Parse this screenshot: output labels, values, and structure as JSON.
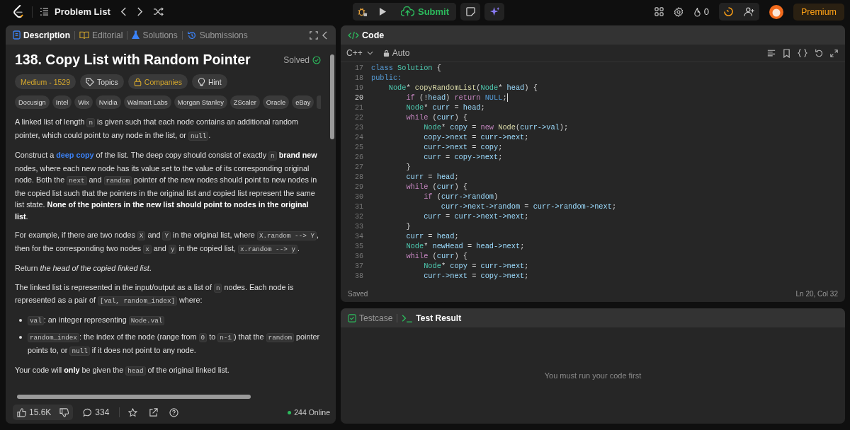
{
  "top_bar": {
    "problem_list": "Problem List",
    "submit": "Submit",
    "streak": "0",
    "premium": "Premium"
  },
  "description_panel": {
    "tabs": [
      {
        "label": "Description",
        "selected": true
      },
      {
        "label": "Editorial",
        "selected": false
      },
      {
        "label": "Solutions",
        "selected": false
      },
      {
        "label": "Submissions",
        "selected": false
      }
    ],
    "title": "138. Copy List with Random Pointer",
    "status": "Solved",
    "tags": [
      {
        "kind": "difficulty",
        "label": "Medium - 1529"
      },
      {
        "kind": "topics",
        "label": "Topics"
      },
      {
        "kind": "companies",
        "label": "Companies"
      },
      {
        "kind": "hint",
        "label": "Hint"
      }
    ],
    "companies": [
      "Docusign",
      "Intel",
      "Wix",
      "Nvidia",
      "Walmart Labs",
      "Morgan Stanley",
      "ZScaler",
      "Oracle",
      "eBay"
    ],
    "content": [
      {
        "kind": "paragraph",
        "parts": [
          {
            "kind": "text",
            "text": "A linked list of length "
          },
          {
            "kind": "code",
            "text": "n"
          },
          {
            "kind": "text",
            "text": " is given such that each node contains an additional random pointer, which could point to any node in the list, or "
          },
          {
            "kind": "code",
            "text": "null"
          },
          {
            "kind": "text",
            "text": "."
          }
        ]
      },
      {
        "kind": "paragraph",
        "parts": [
          {
            "kind": "text",
            "text": "Construct a "
          },
          {
            "kind": "link",
            "text": "deep copy"
          },
          {
            "kind": "text",
            "text": " of the list. The deep copy should consist of exactly "
          },
          {
            "kind": "code",
            "text": "n"
          },
          {
            "kind": "text",
            "text": " **brand new** nodes, where each new node has its value set to the value of its corresponding original node. Both the "
          },
          {
            "kind": "code",
            "text": "next"
          },
          {
            "kind": "text",
            "text": " and "
          },
          {
            "kind": "code",
            "text": "random"
          },
          {
            "kind": "text",
            "text": " pointer of the new nodes should point to new nodes in the copied list such that the pointers in the original list and copied list represent the same list state. **None of the pointers in the new list should point to nodes in the original list**."
          }
        ]
      },
      {
        "kind": "paragraph",
        "parts": [
          {
            "kind": "text",
            "text": "For example, if there are two nodes "
          },
          {
            "kind": "code",
            "text": "X"
          },
          {
            "kind": "text",
            "text": " and "
          },
          {
            "kind": "code",
            "text": "Y"
          },
          {
            "kind": "text",
            "text": " in the original list, where "
          },
          {
            "kind": "code",
            "text": "X.random --> Y"
          },
          {
            "kind": "text",
            "text": ", then for the corresponding two nodes "
          },
          {
            "kind": "code",
            "text": "x"
          },
          {
            "kind": "text",
            "text": " and "
          },
          {
            "kind": "code",
            "text": "y"
          },
          {
            "kind": "text",
            "text": " in the copied list, "
          },
          {
            "kind": "code",
            "text": "x.random --> y"
          },
          {
            "kind": "text",
            "text": "."
          }
        ]
      },
      {
        "kind": "paragraph",
        "parts": [
          {
            "kind": "text",
            "text": "Return *the head of the copied linked list*."
          }
        ]
      },
      {
        "kind": "paragraph",
        "parts": [
          {
            "kind": "text",
            "text": "The linked list is represented in the input/output as a list of "
          },
          {
            "kind": "code",
            "text": "n"
          },
          {
            "kind": "text",
            "text": " nodes. Each node is represented as a pair of "
          },
          {
            "kind": "code",
            "text": "[val, random_index]"
          },
          {
            "kind": "text",
            "text": " where:"
          }
        ]
      },
      {
        "kind": "bullets",
        "items": [
          {
            "parts": [
              {
                "kind": "code",
                "text": "val"
              },
              {
                "kind": "text",
                "text": ": an integer representing "
              },
              {
                "kind": "code",
                "text": "Node.val"
              }
            ]
          },
          {
            "parts": [
              {
                "kind": "code",
                "text": "random_index"
              },
              {
                "kind": "text",
                "text": ": the index of the node (range from "
              },
              {
                "kind": "code",
                "text": "0"
              },
              {
                "kind": "text",
                "text": " to "
              },
              {
                "kind": "code",
                "text": "n-1"
              },
              {
                "kind": "text",
                "text": ") that the "
              },
              {
                "kind": "code",
                "text": "random"
              },
              {
                "kind": "text",
                "text": " pointer points to, or "
              },
              {
                "kind": "code",
                "text": "null"
              },
              {
                "kind": "text",
                "text": " if it does not point to any node."
              }
            ]
          }
        ]
      },
      {
        "kind": "paragraph",
        "parts": [
          {
            "kind": "text",
            "text": "Your code will **only** be given the "
          },
          {
            "kind": "code",
            "text": "head"
          },
          {
            "kind": "text",
            "text": " of the original linked list."
          }
        ]
      }
    ],
    "footer": {
      "likes": "15.6K",
      "comments": "334",
      "online": "244 Online"
    }
  },
  "code_panel": {
    "title": "Code",
    "language": "C++",
    "mode": "Auto",
    "lines": [
      {
        "number": "17",
        "current": false,
        "tokens": [
          {
            "kind": "storage",
            "text": "class "
          },
          {
            "kind": "type",
            "text": "Solution"
          },
          {
            "kind": "plain",
            "text": " {"
          }
        ]
      },
      {
        "number": "18",
        "current": false,
        "tokens": [
          {
            "kind": "storage",
            "text": "public:"
          }
        ]
      },
      {
        "number": "19",
        "current": false,
        "tokens": [
          {
            "kind": "type",
            "text": "    Node"
          },
          {
            "kind": "plain",
            "text": "* "
          },
          {
            "kind": "function",
            "text": "copyRandomList"
          },
          {
            "kind": "plain",
            "text": "("
          },
          {
            "kind": "type",
            "text": "Node"
          },
          {
            "kind": "plain",
            "text": "* "
          },
          {
            "kind": "variable",
            "text": "head"
          },
          {
            "kind": "plain",
            "text": ") {"
          }
        ]
      },
      {
        "number": "20",
        "current": true,
        "tokens": [
          {
            "kind": "keyword",
            "text": "        if"
          },
          {
            "kind": "plain",
            "text": " (!"
          },
          {
            "kind": "variable",
            "text": "head"
          },
          {
            "kind": "plain",
            "text": ") "
          },
          {
            "kind": "keyword",
            "text": "return"
          },
          {
            "kind": "storage",
            "text": " NULL"
          },
          {
            "kind": "plain",
            "text": ";"
          }
        ]
      },
      {
        "number": "21",
        "current": false,
        "tokens": [
          {
            "kind": "type",
            "text": "        Node"
          },
          {
            "kind": "plain",
            "text": "* "
          },
          {
            "kind": "variable",
            "text": "curr"
          },
          {
            "kind": "plain",
            "text": " = "
          },
          {
            "kind": "variable",
            "text": "head"
          },
          {
            "kind": "plain",
            "text": ";"
          }
        ]
      },
      {
        "number": "22",
        "current": false,
        "tokens": [
          {
            "kind": "keyword",
            "text": "        while"
          },
          {
            "kind": "plain",
            "text": " ("
          },
          {
            "kind": "variable",
            "text": "curr"
          },
          {
            "kind": "plain",
            "text": ") {"
          }
        ]
      },
      {
        "number": "23",
        "current": false,
        "tokens": [
          {
            "kind": "type",
            "text": "            Node"
          },
          {
            "kind": "plain",
            "text": "* "
          },
          {
            "kind": "variable",
            "text": "copy"
          },
          {
            "kind": "plain",
            "text": " = "
          },
          {
            "kind": "keyword",
            "text": "new"
          },
          {
            "kind": "function",
            "text": " Node"
          },
          {
            "kind": "plain",
            "text": "("
          },
          {
            "kind": "variable",
            "text": "curr->val"
          },
          {
            "kind": "plain",
            "text": ");"
          }
        ]
      },
      {
        "number": "24",
        "current": false,
        "tokens": [
          {
            "kind": "variable",
            "text": "            copy->next"
          },
          {
            "kind": "plain",
            "text": " = "
          },
          {
            "kind": "variable",
            "text": "curr->next"
          },
          {
            "kind": "plain",
            "text": ";"
          }
        ]
      },
      {
        "number": "25",
        "current": false,
        "tokens": [
          {
            "kind": "variable",
            "text": "            curr->next"
          },
          {
            "kind": "plain",
            "text": " = "
          },
          {
            "kind": "variable",
            "text": "copy"
          },
          {
            "kind": "plain",
            "text": ";"
          }
        ]
      },
      {
        "number": "26",
        "current": false,
        "tokens": [
          {
            "kind": "variable",
            "text": "            curr"
          },
          {
            "kind": "plain",
            "text": " = "
          },
          {
            "kind": "variable",
            "text": "copy->next"
          },
          {
            "kind": "plain",
            "text": ";"
          }
        ]
      },
      {
        "number": "27",
        "current": false,
        "tokens": [
          {
            "kind": "plain",
            "text": "        }"
          }
        ]
      },
      {
        "number": "28",
        "current": false,
        "tokens": [
          {
            "kind": "variable",
            "text": "        curr"
          },
          {
            "kind": "plain",
            "text": " = "
          },
          {
            "kind": "variable",
            "text": "head"
          },
          {
            "kind": "plain",
            "text": ";"
          }
        ]
      },
      {
        "number": "29",
        "current": false,
        "tokens": [
          {
            "kind": "keyword",
            "text": "        while"
          },
          {
            "kind": "plain",
            "text": " ("
          },
          {
            "kind": "variable",
            "text": "curr"
          },
          {
            "kind": "plain",
            "text": ") {"
          }
        ]
      },
      {
        "number": "30",
        "current": false,
        "tokens": [
          {
            "kind": "keyword",
            "text": "            if"
          },
          {
            "kind": "plain",
            "text": " ("
          },
          {
            "kind": "variable",
            "text": "curr->random"
          },
          {
            "kind": "plain",
            "text": ")"
          }
        ]
      },
      {
        "number": "31",
        "current": false,
        "tokens": [
          {
            "kind": "variable",
            "text": "                curr->next->random"
          },
          {
            "kind": "plain",
            "text": " = "
          },
          {
            "kind": "variable",
            "text": "curr->random->next"
          },
          {
            "kind": "plain",
            "text": ";"
          }
        ]
      },
      {
        "number": "32",
        "current": false,
        "tokens": [
          {
            "kind": "variable",
            "text": "            curr"
          },
          {
            "kind": "plain",
            "text": " = "
          },
          {
            "kind": "variable",
            "text": "curr->next->next"
          },
          {
            "kind": "plain",
            "text": ";"
          }
        ]
      },
      {
        "number": "33",
        "current": false,
        "tokens": [
          {
            "kind": "plain",
            "text": "        }"
          }
        ]
      },
      {
        "number": "34",
        "current": false,
        "tokens": [
          {
            "kind": "variable",
            "text": "        curr"
          },
          {
            "kind": "plain",
            "text": " = "
          },
          {
            "kind": "variable",
            "text": "head"
          },
          {
            "kind": "plain",
            "text": ";"
          }
        ]
      },
      {
        "number": "35",
        "current": false,
        "tokens": [
          {
            "kind": "type",
            "text": "        Node"
          },
          {
            "kind": "plain",
            "text": "* "
          },
          {
            "kind": "variable",
            "text": "newHead"
          },
          {
            "kind": "plain",
            "text": " = "
          },
          {
            "kind": "variable",
            "text": "head->next"
          },
          {
            "kind": "plain",
            "text": ";"
          }
        ]
      },
      {
        "number": "36",
        "current": false,
        "tokens": [
          {
            "kind": "keyword",
            "text": "        while"
          },
          {
            "kind": "plain",
            "text": " ("
          },
          {
            "kind": "variable",
            "text": "curr"
          },
          {
            "kind": "plain",
            "text": ") {"
          }
        ]
      },
      {
        "number": "37",
        "current": false,
        "tokens": [
          {
            "kind": "type",
            "text": "            Node"
          },
          {
            "kind": "plain",
            "text": "* "
          },
          {
            "kind": "variable",
            "text": "copy"
          },
          {
            "kind": "plain",
            "text": " = "
          },
          {
            "kind": "variable",
            "text": "curr->next"
          },
          {
            "kind": "plain",
            "text": ";"
          }
        ]
      },
      {
        "number": "38",
        "current": false,
        "tokens": [
          {
            "kind": "variable",
            "text": "            curr->next"
          },
          {
            "kind": "plain",
            "text": " = "
          },
          {
            "kind": "variable",
            "text": "copy->next"
          },
          {
            "kind": "plain",
            "text": ";"
          }
        ]
      }
    ],
    "save_status": "Saved",
    "cursor": "Ln 20, Col 32"
  },
  "result_panel": {
    "tabs": [
      {
        "label": "Testcase",
        "selected": false
      },
      {
        "label": "Test Result",
        "selected": true
      }
    ],
    "message": "You must run your code first"
  }
}
